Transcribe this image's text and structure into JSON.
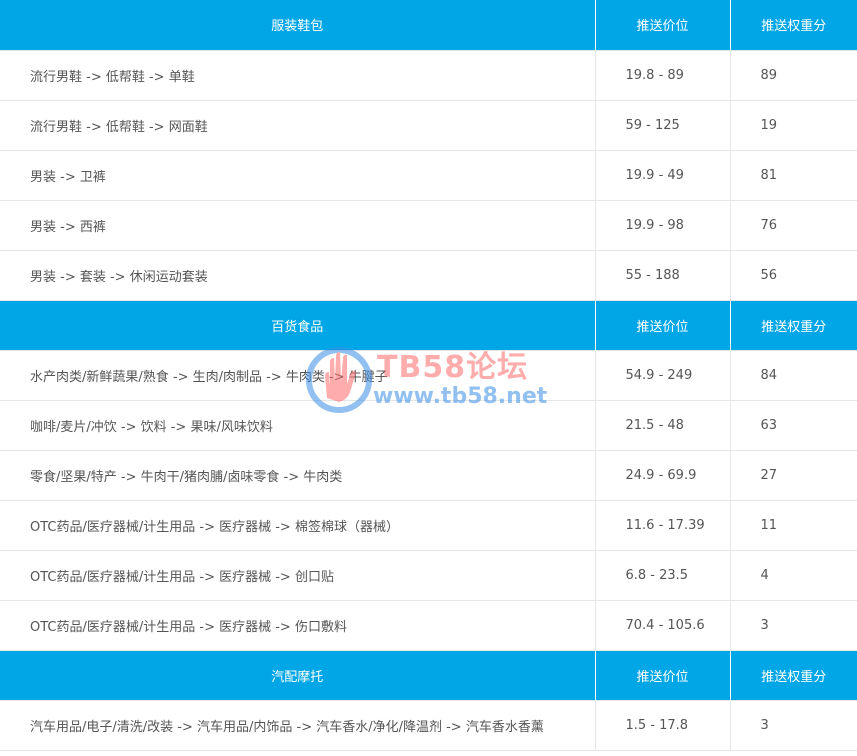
{
  "sections": [
    {
      "category": "服装鞋包",
      "price_header": "推送价位",
      "weight_header": "推送权重分",
      "rows": [
        {
          "path": "流行男鞋 -> 低帮鞋 -> 单鞋",
          "price": "19.8 - 89",
          "weight": "89"
        },
        {
          "path": "流行男鞋 -> 低帮鞋 -> 网面鞋",
          "price": "59 - 125",
          "weight": "19"
        },
        {
          "path": "男装 -> 卫裤",
          "price": "19.9 - 49",
          "weight": "81"
        },
        {
          "path": "男装 -> 西裤",
          "price": "19.9 - 98",
          "weight": "76"
        },
        {
          "path": "男装 -> 套装 -> 休闲运动套装",
          "price": "55 - 188",
          "weight": "56"
        }
      ]
    },
    {
      "category": "百货食品",
      "price_header": "推送价位",
      "weight_header": "推送权重分",
      "rows": [
        {
          "path": "水产肉类/新鲜蔬果/熟食 -> 生肉/肉制品 -> 牛肉类 -> 牛腱子",
          "price": "54.9 - 249",
          "weight": "84"
        },
        {
          "path": "咖啡/麦片/冲饮 -> 饮料 -> 果味/风味饮料",
          "price": "21.5 - 48",
          "weight": "63"
        },
        {
          "path": "零食/坚果/特产 -> 牛肉干/猪肉脯/卤味零食 -> 牛肉类",
          "price": "24.9 - 69.9",
          "weight": "27"
        },
        {
          "path": "OTC药品/医疗器械/计生用品 -> 医疗器械 -> 棉签棉球（器械）",
          "price": "11.6 - 17.39",
          "weight": "11"
        },
        {
          "path": "OTC药品/医疗器械/计生用品 -> 医疗器械 -> 创口贴",
          "price": "6.8 - 23.5",
          "weight": "4"
        },
        {
          "path": "OTC药品/医疗器械/计生用品 -> 医疗器械 -> 伤口敷料",
          "price": "70.4 - 105.6",
          "weight": "3"
        }
      ]
    },
    {
      "category": "汽配摩托",
      "price_header": "推送价位",
      "weight_header": "推送权重分",
      "rows": [
        {
          "path": "汽车用品/电子/清洗/改装 -> 汽车用品/内饰品 -> 汽车香水/净化/降温剂 -> 汽车香水香薰",
          "price": "1.5 - 17.8",
          "weight": "3"
        }
      ]
    }
  ],
  "watermark": {
    "title": "TB58论坛",
    "url": "www.tb58.net"
  }
}
